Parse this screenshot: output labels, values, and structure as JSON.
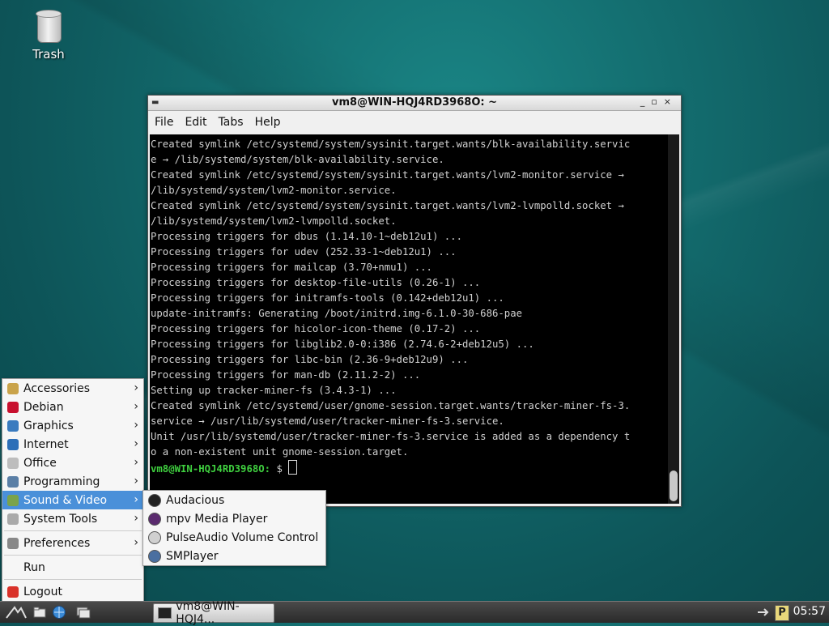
{
  "desktop": {
    "trash_label": "Trash"
  },
  "terminal": {
    "title": "vm8@WIN-HQJ4RD3968O: ~",
    "menu": [
      "File",
      "Edit",
      "Tabs",
      "Help"
    ],
    "lines": [
      "Created symlink /etc/systemd/system/sysinit.target.wants/blk-availability.servic",
      "e → /lib/systemd/system/blk-availability.service.",
      "Created symlink /etc/systemd/system/sysinit.target.wants/lvm2-monitor.service →",
      "/lib/systemd/system/lvm2-monitor.service.",
      "Created symlink /etc/systemd/system/sysinit.target.wants/lvm2-lvmpolld.socket →",
      "/lib/systemd/system/lvm2-lvmpolld.socket.",
      "Processing triggers for dbus (1.14.10-1~deb12u1) ...",
      "Processing triggers for udev (252.33-1~deb12u1) ...",
      "Processing triggers for mailcap (3.70+nmu1) ...",
      "Processing triggers for desktop-file-utils (0.26-1) ...",
      "Processing triggers for initramfs-tools (0.142+deb12u1) ...",
      "update-initramfs: Generating /boot/initrd.img-6.1.0-30-686-pae",
      "Processing triggers for hicolor-icon-theme (0.17-2) ...",
      "Processing triggers for libglib2.0-0:i386 (2.74.6-2+deb12u5) ...",
      "Processing triggers for libc-bin (2.36-9+deb12u9) ...",
      "Processing triggers for man-db (2.11.2-2) ...",
      "Setting up tracker-miner-fs (3.4.3-1) ...",
      "Created symlink /etc/systemd/user/gnome-session.target.wants/tracker-miner-fs-3.",
      "service → /usr/lib/systemd/user/tracker-miner-fs-3.service.",
      "Unit /usr/lib/systemd/user/tracker-miner-fs-3.service is added as a dependency t",
      "o a non-existent unit gnome-session.target."
    ],
    "prompt": "vm8@WIN-HQJ4RD3968O:",
    "prompt_suffix": " $ "
  },
  "menu": {
    "items": [
      {
        "label": "Accessories",
        "icon": "accessories-icon",
        "color": "#c9a34a",
        "arrow": true
      },
      {
        "label": "Debian",
        "icon": "debian-icon",
        "color": "#c8102e",
        "arrow": true
      },
      {
        "label": "Graphics",
        "icon": "graphics-icon",
        "color": "#3a7bbf",
        "arrow": true
      },
      {
        "label": "Internet",
        "icon": "internet-icon",
        "color": "#2d6fb8",
        "arrow": true
      },
      {
        "label": "Office",
        "icon": "office-icon",
        "color": "#bdbdbd",
        "arrow": true
      },
      {
        "label": "Programming",
        "icon": "programming-icon",
        "color": "#5a7fa6",
        "arrow": true
      },
      {
        "label": "Sound & Video",
        "icon": "sound-video-icon",
        "color": "#7aa34a",
        "arrow": true
      },
      {
        "label": "System Tools",
        "icon": "system-tools-icon",
        "color": "#aaaaaa",
        "arrow": true
      },
      {
        "label": "Preferences",
        "icon": "preferences-icon",
        "color": "#888888",
        "arrow": true
      },
      {
        "label": "Run",
        "icon": "",
        "color": "",
        "arrow": false
      },
      {
        "label": "Logout",
        "icon": "logout-icon",
        "color": "#d9322a",
        "arrow": false
      }
    ]
  },
  "submenu": {
    "items": [
      {
        "label": "Audacious",
        "icon": "audacious-icon",
        "color": "#222222"
      },
      {
        "label": "mpv Media Player",
        "icon": "mpv-icon",
        "color": "#5a2a6e"
      },
      {
        "label": "PulseAudio Volume Control",
        "icon": "pulseaudio-icon",
        "color": "#d0d0d0"
      },
      {
        "label": "SMPlayer",
        "icon": "smplayer-icon",
        "color": "#4a6fa0"
      }
    ]
  },
  "taskbar": {
    "task_label": "vm8@WIN-HQJ4...",
    "clock": "05:57",
    "tray_label": "P"
  }
}
